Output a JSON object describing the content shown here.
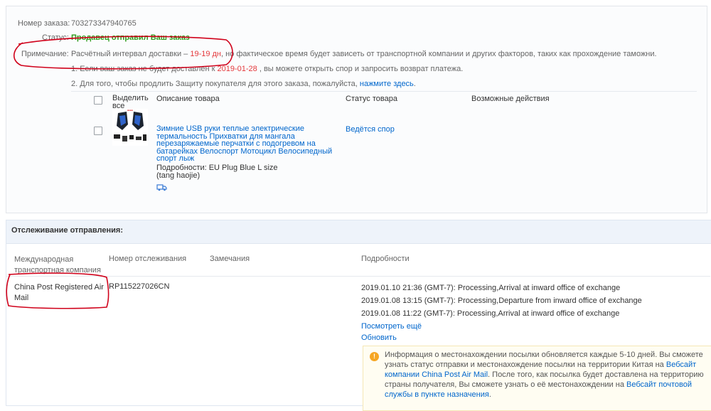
{
  "order": {
    "number_label": "Номер заказа:",
    "number_value": "703273347940765",
    "status_label": "Статус:",
    "status_value": "Продавец отправил Ваш заказ",
    "note_label": "Примечание:",
    "note_prefix": "Расчётный интервал доставки –",
    "note_days": "19-19 дн",
    "note_suffix": ", но фактическое время будет зависеть от транспортной компании и других факторов, таких как прохождение таможни.",
    "line1_prefix": "1. Если ваш заказ не будет доставлен к",
    "line1_date": "2019-01-28",
    "line1_suffix": ", вы можете открыть спор и запросить возврат платежа.",
    "line2_prefix": "2. Для того, чтобы продлить Защиту покупателя для этого заказа, пожалуйста,",
    "line2_link": "нажмите здесь",
    "line2_end": "."
  },
  "items_table": {
    "headers": {
      "select_all_l1": "Выделить",
      "select_all_l2": "все",
      "description": "Описание товара",
      "status": "Статус товара",
      "actions": "Возможные действия"
    },
    "product": {
      "title_lines": [
        "Зимние USB руки теплые электрические",
        "термальность Прихватки для мангала",
        "перезаряжаемые перчатки с подогревом на",
        "батарейках Велоспорт Мотоцикл Велосипедный",
        "спорт лыж"
      ],
      "details": "Подробности: EU Plug Blue L size",
      "seller": "(tang haojie)",
      "status": "Ведётся спор"
    }
  },
  "tracking": {
    "title": "Отслеживание отправления:",
    "headers": {
      "carrier_l1": "Международная",
      "carrier_l2": "транспортная компания",
      "number": "Номер отслеживания",
      "remarks": "Замечания",
      "details": "Подробности"
    },
    "carrier_l1": "China Post Registered Air",
    "carrier_l2": "Mail",
    "tracking_number": "RP115227026CN",
    "events": [
      "2019.01.10 21:36 (GMT-7): Processing,Arrival at inward office of exchange",
      "2019.01.08 13:15 (GMT-7): Processing,Departure from inward office of exchange",
      "2019.01.08 11:22 (GMT-7): Processing,Arrival at inward office of exchange"
    ],
    "view_more": "Посмотреть ещё",
    "refresh": "Обновить",
    "info": {
      "l1": "Информация о местонахождении посылки обновляется каждые 5-10 дней. Вы сможете",
      "l2": "узнать статус отправки и местонахождение посылки на территории Китая на",
      "l2_link": "Вебсайт",
      "l3_link": "компании China Post Air Mail",
      "l3": ". После того, как посылка будет доставлена на территорию",
      "l4": "страны получателя, Вы сможете узнать о её местонахождении на",
      "l4_link": "Вебсайт почтовой",
      "l5_link": "службы в пункте назначения",
      "l5": "."
    }
  },
  "colors": {
    "link": "#0066cc",
    "status_green": "#2f9e1f",
    "highlight_red": "#e4393c",
    "annotation": "#d0021b"
  }
}
